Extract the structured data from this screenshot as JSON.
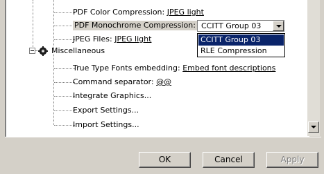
{
  "tree": {
    "pdf_color": {
      "label": "PDF Color Compression: ",
      "value": "JPEG light"
    },
    "pdf_mono": {
      "label": "PDF Monochrome Compression:"
    },
    "jpeg_files": {
      "label": "JPEG Files: ",
      "value": "JPEG light"
    },
    "misc": {
      "label": "Miscellaneous",
      "icon": "gear-icon"
    },
    "truetype": {
      "label": "True Type Fonts embedding: ",
      "value": "Embed font descriptions"
    },
    "cmd_sep": {
      "label": "Command separator: ",
      "value": "@@"
    },
    "integrate": {
      "label": "Integrate Graphics..."
    },
    "export": {
      "label": "Export Settings..."
    },
    "import": {
      "label": "Import Settings..."
    }
  },
  "combo": {
    "selected": "CCITT Group 03",
    "options": [
      "CCITT Group 03",
      "RLE Compression"
    ]
  },
  "buttons": {
    "ok": "OK",
    "cancel": "Cancel",
    "apply": "Apply"
  },
  "colors": {
    "selection": "#0a246a",
    "face": "#d4d0c8"
  }
}
